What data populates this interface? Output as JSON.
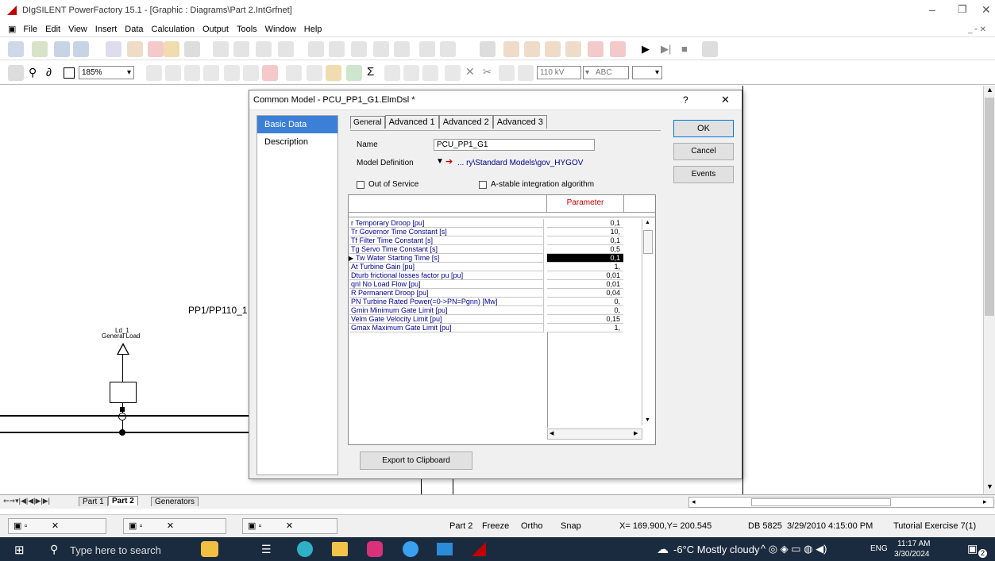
{
  "window": {
    "title": "DIgSILENT PowerFactory 15.1 - [Graphic : Diagrams\\Part 2.IntGrfnet]"
  },
  "menu": [
    "File",
    "Edit",
    "View",
    "Insert",
    "Data",
    "Calculation",
    "Output",
    "Tools",
    "Window",
    "Help"
  ],
  "toolbar2": {
    "zoom": "185%",
    "voltage": "110 kV",
    "abc": "ABC"
  },
  "canvas": {
    "pp_label": "PP1/PP110_1",
    "load_label": "Ld_1",
    "load_type": "General Load"
  },
  "sheet_tabs": [
    "Part 1",
    "Part 2",
    "Generators"
  ],
  "dialog": {
    "title": "Common Model - PCU_PP1_G1.ElmDsl *",
    "help": "?",
    "close": "✕",
    "nav": [
      "Basic Data",
      "Description"
    ],
    "tabs": [
      "General",
      "Advanced 1",
      "Advanced 2",
      "Advanced 3"
    ],
    "name_label": "Name",
    "name_value": "PCU_PP1_G1",
    "model_def_label": "Model Definition",
    "model_def_value": "... ry\\Standard Models\\gov_HYGOV",
    "out_of_service": "Out of Service",
    "astable": "A-stable integration algorithm",
    "param_header": "Parameter",
    "ok": "OK",
    "cancel": "Cancel",
    "events": "Events",
    "export": "Export to Clipboard",
    "rows": [
      {
        "name": "r   Temporary Droop [pu]",
        "value": "0,1"
      },
      {
        "name": "Tr   Governor Time Constant [s]",
        "value": "10,"
      },
      {
        "name": "Tf   Filter Time Constant [s]",
        "value": "0,1"
      },
      {
        "name": "Tg   Servo Time Constant [s]",
        "value": "0,5"
      },
      {
        "name": "Tw   Water Starting Time [s]",
        "value": "0,1"
      },
      {
        "name": "At   Turbine Gain [pu]",
        "value": "1,"
      },
      {
        "name": "Dturb frictional losses factor pu [pu]",
        "value": "0,01"
      },
      {
        "name": "qnl   No Load Flow [pu]",
        "value": "0,01"
      },
      {
        "name": "R   Permanent Droop [pu]",
        "value": "0,04"
      },
      {
        "name": "PN   Turbine Rated Power(=0->PN=Pgnn) [Mw]",
        "value": "0,"
      },
      {
        "name": "Gmin  Minimum Gate Limit [pu]",
        "value": "0,"
      },
      {
        "name": "Velm  Gate Velocity Limit [pu]",
        "value": "0,15"
      },
      {
        "name": "Gmax  Maximum Gate Limit [pu]",
        "value": "1,"
      }
    ]
  },
  "status": {
    "part": "Part 2",
    "freeze": "Freeze",
    "ortho": "Ortho",
    "snap": "Snap",
    "coords": "X=  169.900,Y=  200.545",
    "db": "DB 5825",
    "date": "3/29/2010 4:15:00 PM",
    "tutorial": "Tutorial Exercise 7(1)"
  },
  "taskbar": {
    "search": "Type here to search",
    "weather": "-6°C  Mostly cloudy",
    "lang": "ENG",
    "time": "11:17 AM",
    "date": "3/30/2024",
    "notif": "2"
  }
}
